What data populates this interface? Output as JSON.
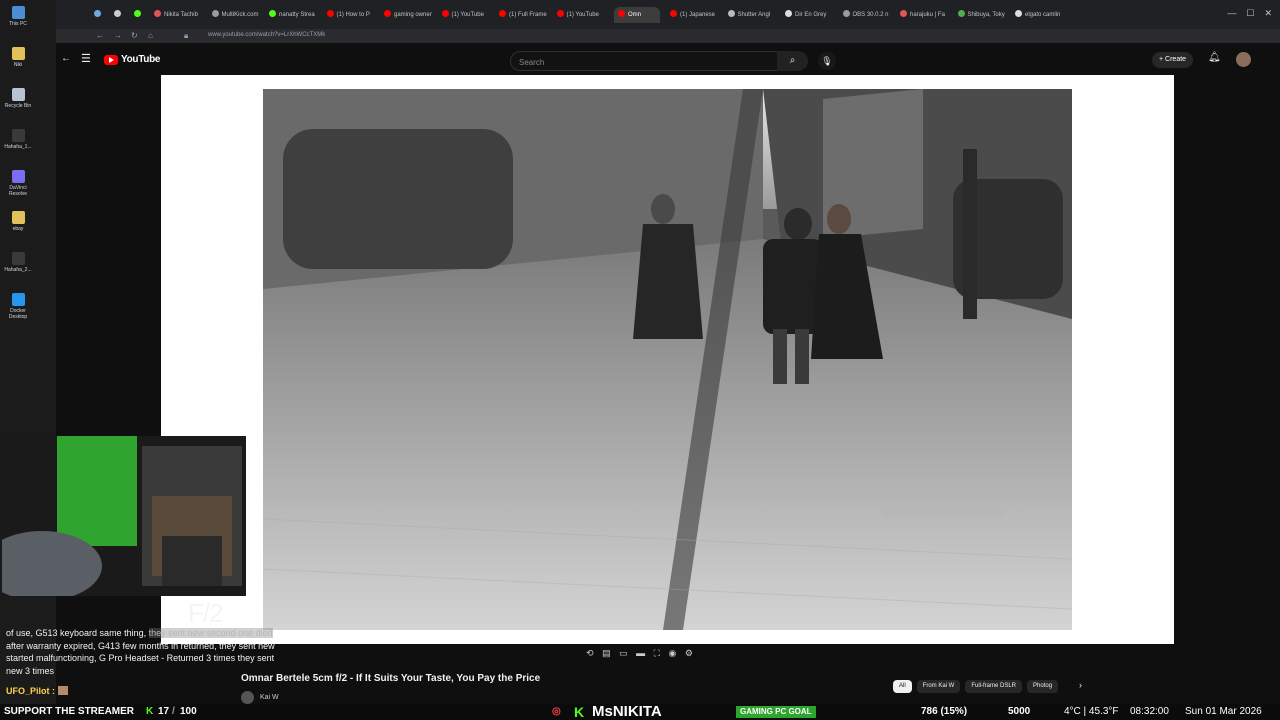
{
  "desktop_icons": [
    {
      "label": "This PC",
      "color": "#4a8fd6"
    },
    {
      "label": "Niki",
      "color": "#e2c15a"
    },
    {
      "label": "Recycle Bin",
      "color": "#b8c4d2"
    },
    {
      "label": "Hahaha_1...",
      "color": "#3a3a3a"
    },
    {
      "label": "DaVinci Resolve",
      "color": "#7a6df0"
    },
    {
      "label": "ebay",
      "color": "#e2c15a"
    },
    {
      "label": "Hahaha_2...",
      "color": "#3a3a3a"
    },
    {
      "label": "Docker Desktop",
      "color": "#2496ed"
    }
  ],
  "browser": {
    "tabs": [
      {
        "label": "",
        "icon": "P",
        "color": "#6fa8dc"
      },
      {
        "label": "",
        "icon": "X",
        "color": "#cccccc"
      },
      {
        "label": "",
        "icon": "K",
        "color": "#53fc18"
      },
      {
        "label": "Nikita Tachib",
        "color": "#e05555"
      },
      {
        "label": "MultiKick.com",
        "color": "#9b9b9b"
      },
      {
        "label": "nanatty Strea",
        "color": "#53fc18"
      },
      {
        "label": "(1) How to P",
        "color": "#ff0000"
      },
      {
        "label": "gaming owner",
        "color": "#ff0000"
      },
      {
        "label": "(1) YouTube",
        "color": "#ff0000"
      },
      {
        "label": "(1) Full Frame",
        "color": "#ff0000"
      },
      {
        "label": "(1) YouTube",
        "color": "#ff0000"
      },
      {
        "label": "Omn",
        "color": "#ff0000",
        "active": true
      },
      {
        "label": "(1) Japanese",
        "color": "#ff0000"
      },
      {
        "label": "Shutter Angl",
        "color": "#bbbbbb"
      },
      {
        "label": "Dir En Grey",
        "color": "#dddddd"
      },
      {
        "label": "OBS 30.0.2 n",
        "color": "#9b9b9b"
      },
      {
        "label": "harajuku | Fa",
        "color": "#e05555"
      },
      {
        "label": "Shibuya, Toky",
        "color": "#4caf50"
      },
      {
        "label": "elgato camlin",
        "color": "#dddddd"
      }
    ],
    "url": "www.youtube.com/watch?v=LrXhWCcTXMk"
  },
  "youtube": {
    "logo_text": "YouTube",
    "search_placeholder": "Search",
    "create_label": "Create"
  },
  "video": {
    "title": "Omnar Bertele 5cm f/2 - If It Suits Your Taste, You Pay the Price",
    "channel": "Kai W",
    "chips": [
      "All",
      "From Kai W",
      "Full-frame DSLR",
      "Photog"
    ]
  },
  "overlay": {
    "f_stop": "F/2",
    "chat_lines": [
      {
        "text": "of use, G513 keyboard same thing, ",
        "dim": "they sent new second one died"
      },
      {
        "text": "after warranty expired, G413 few months in returned, they sent new"
      },
      {
        "text": "started malfunctioning, G Pro Headset - Returned 3 times they sent"
      },
      {
        "text": "new 3 times"
      }
    ],
    "chat_user": "UFO_Pilot :",
    "ticker": {
      "support": "SUPPORT THE STREAMER",
      "kick_count": "17",
      "goal_value": "100",
      "streamer": "MsNIKITA",
      "goal_label": "GAMING PC GOAL",
      "goal_progress": "786 (15%)",
      "goal_target": "5000",
      "weather": "4°C | 45.3°F",
      "time": "08:32:00",
      "date": "Sun 01 Mar 2026"
    }
  }
}
